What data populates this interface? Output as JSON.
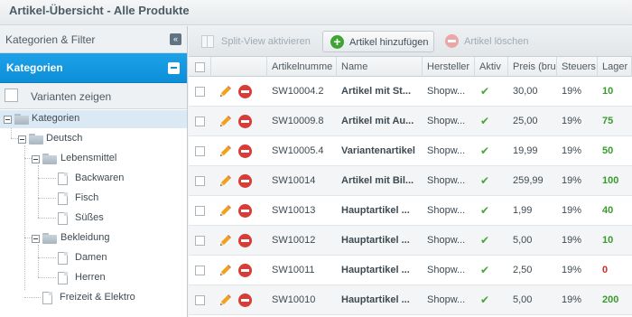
{
  "window": {
    "title": "Artikel-Übersicht - Alle Produkte"
  },
  "sidebar": {
    "filter_title": "Kategorien & Filter",
    "categories_title": "Kategorien",
    "variants_label": "Varianten zeigen",
    "tree": [
      {
        "label": "Kategorien",
        "type": "folder",
        "expanded": true,
        "selected": true
      },
      {
        "label": "Deutsch",
        "type": "folder",
        "expanded": true
      },
      {
        "label": "Lebensmittel",
        "type": "folder",
        "expanded": true
      },
      {
        "label": "Backwaren",
        "type": "leaf"
      },
      {
        "label": "Fisch",
        "type": "leaf"
      },
      {
        "label": "Süßes",
        "type": "leaf"
      },
      {
        "label": "Bekleidung",
        "type": "folder",
        "expanded": true
      },
      {
        "label": "Damen",
        "type": "leaf"
      },
      {
        "label": "Herren",
        "type": "leaf"
      },
      {
        "label": "Freizeit & Elektro",
        "type": "leaf"
      }
    ]
  },
  "toolbar": {
    "split_view_label": "Split-View aktivieren",
    "add_label": "Artikel hinzufügen",
    "delete_label": "Artikel löschen"
  },
  "grid": {
    "columns": [
      "Artikelnumme",
      "Name",
      "Hersteller",
      "Aktiv",
      "Preis (bru",
      "Steuers",
      "Lager"
    ],
    "rows": [
      {
        "number": "SW10004.2",
        "name": "Artikel mit St...",
        "manufacturer": "Shopw...",
        "active": "✔",
        "price": "30,00",
        "tax": "19%",
        "stock": "10"
      },
      {
        "number": "SW10009.8",
        "name": "Artikel mit Au...",
        "manufacturer": "Shopw...",
        "active": "✔",
        "price": "25,00",
        "tax": "19%",
        "stock": "75"
      },
      {
        "number": "SW10005.4",
        "name": "Variantenartikel",
        "manufacturer": "Shopw...",
        "active": "✔",
        "price": "19,99",
        "tax": "19%",
        "stock": "50"
      },
      {
        "number": "SW10014",
        "name": "Artikel mit Bil...",
        "manufacturer": "Shopw...",
        "active": "✔",
        "price": "259,99",
        "tax": "19%",
        "stock": "100"
      },
      {
        "number": "SW10013",
        "name": "Hauptartikel ...",
        "manufacturer": "Shopw...",
        "active": "✔",
        "price": "1,99",
        "tax": "19%",
        "stock": "40"
      },
      {
        "number": "SW10012",
        "name": "Hauptartikel ...",
        "manufacturer": "Shopw...",
        "active": "✔",
        "price": "5,00",
        "tax": "19%",
        "stock": "10"
      },
      {
        "number": "SW10011",
        "name": "Hauptartikel ...",
        "manufacturer": "Shopw...",
        "active": "✔",
        "price": "2,50",
        "tax": "19%",
        "stock": "0"
      },
      {
        "number": "SW10010",
        "name": "Hauptartikel ...",
        "manufacturer": "Shopw...",
        "active": "✔",
        "price": "5,00",
        "tax": "19%",
        "stock": "200"
      }
    ]
  },
  "colors": {
    "accent": "#1a9ee6",
    "add_green": "#3fa434",
    "delete_red": "#d93b36",
    "stock_positive": "#3a9b2d",
    "stock_zero": "#d22a23"
  },
  "icons": {
    "edit": "pencil-icon",
    "delete": "delete-icon",
    "active": "checkmark-icon",
    "folder": "folder-icon",
    "leaf": "document-icon"
  }
}
